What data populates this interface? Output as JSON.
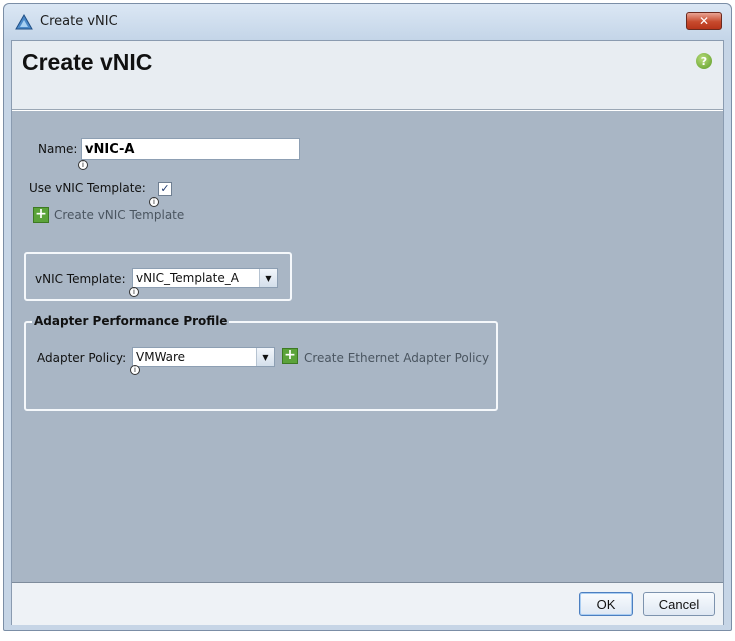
{
  "window": {
    "title": "Create vNIC",
    "close_label": "✕"
  },
  "header": {
    "title": "Create vNIC",
    "help_label": "?"
  },
  "form": {
    "name_label": "Name:",
    "name_value": "vNIC-A",
    "use_template_label": "Use vNIC Template:",
    "use_template_checked": true,
    "create_template_link": "Create vNIC Template",
    "template_label": "vNIC Template:",
    "template_value": "vNIC_Template_A"
  },
  "adapter_group": {
    "legend": "Adapter Performance Profile",
    "policy_label": "Adapter Policy:",
    "policy_value": "VMWare",
    "create_policy_link": "Create Ethernet Adapter Policy"
  },
  "footer": {
    "ok_label": "OK",
    "cancel_label": "Cancel"
  },
  "icons": {
    "checkmark": "✓",
    "plus": "+",
    "dropdown": "▼",
    "info": "i"
  },
  "colors": {
    "accent_green": "#5ba33a",
    "close_red": "#c74a2d",
    "panel_gray": "#a9b6c5"
  }
}
